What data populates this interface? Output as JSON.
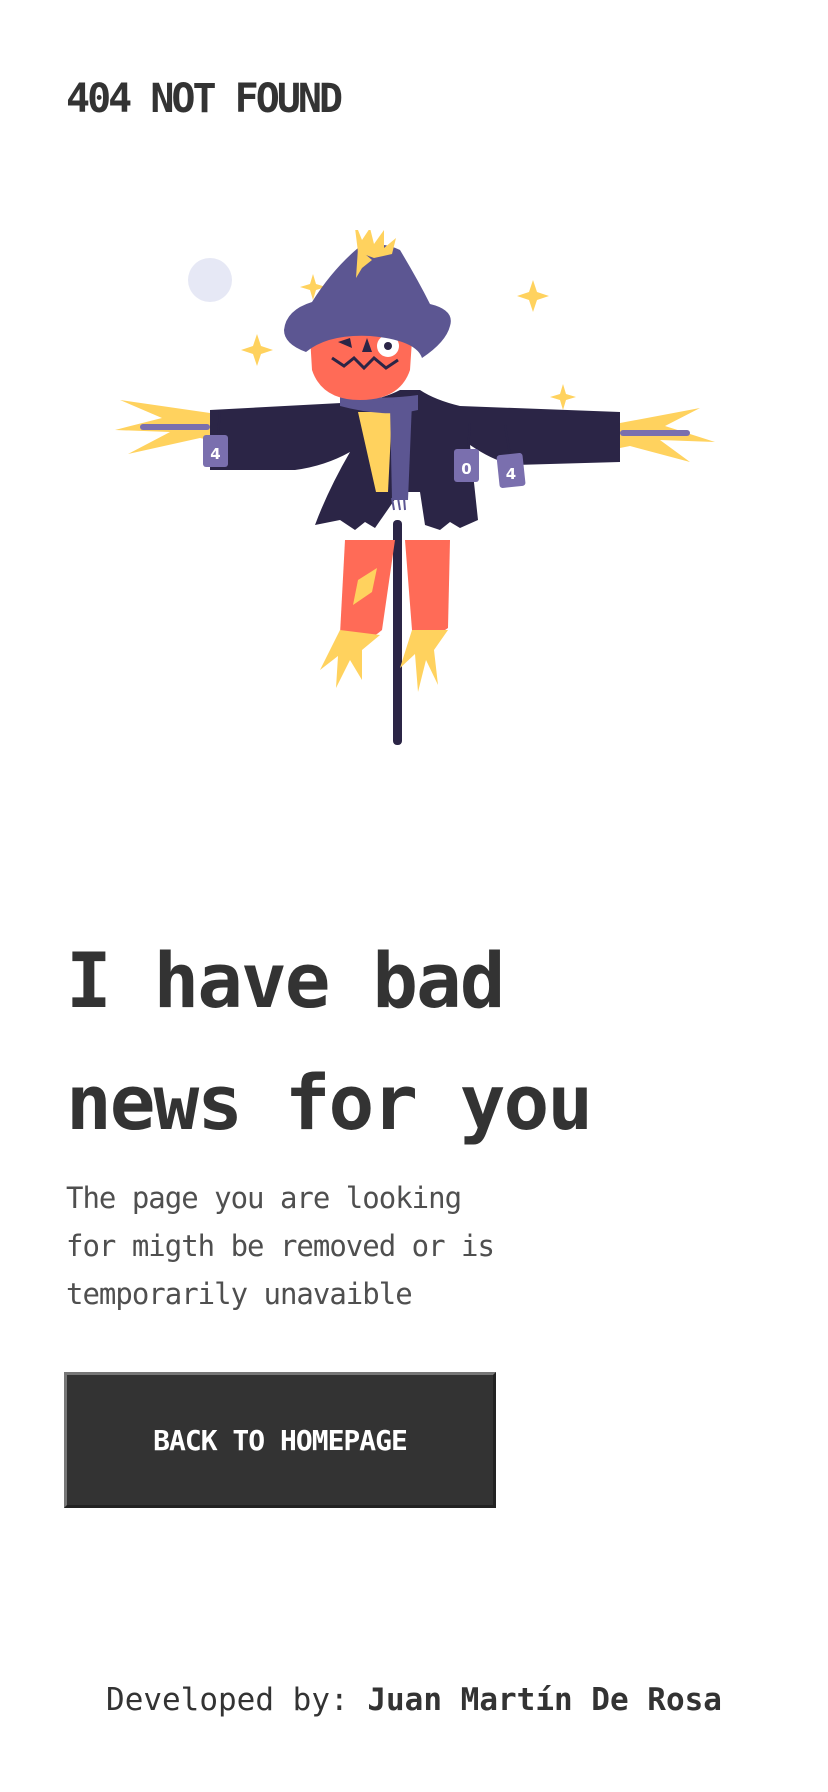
{
  "header": {
    "title": "404 NOT FOUND"
  },
  "illustration": {
    "icon": "scarecrow-illustration",
    "cans": [
      "4",
      "0",
      "4"
    ]
  },
  "main": {
    "headline_line1": "I have bad",
    "headline_line2": "news for you",
    "description_line1": "The page you are looking",
    "description_line2": "for migth be removed or is",
    "description_line3": "temporarily unavaible",
    "button_label": "BACK TO HOMEPAGE"
  },
  "footer": {
    "prefix": "Developed by:",
    "author": "Juan Martín De Rosa"
  },
  "colors": {
    "text": "#333333",
    "button_bg": "#333333",
    "button_text": "#ffffff",
    "hat": "#5c5692",
    "coat": "#2b2546",
    "pumpkin": "#ff6b57",
    "straw": "#ffd25e",
    "moon": "#e6e8f5"
  }
}
